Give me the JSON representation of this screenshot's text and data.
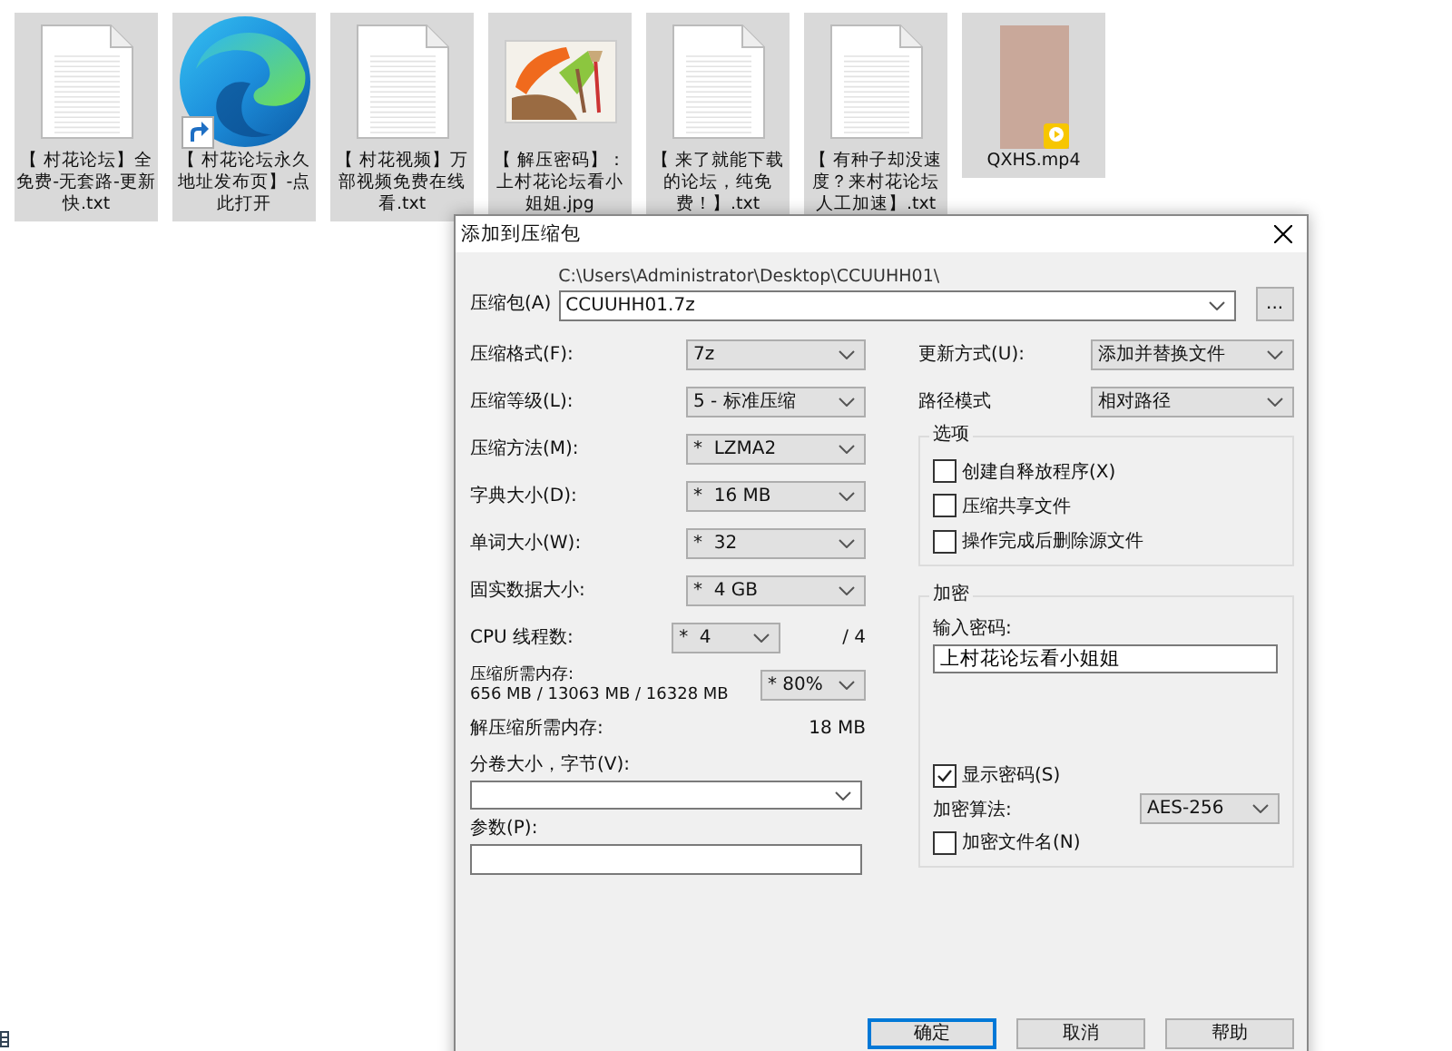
{
  "desktop": {
    "files": [
      {
        "name": "【 村花论坛】全免费-无套路-更新快.txt",
        "kind": "text"
      },
      {
        "name": "【 村花论坛永久地址发布页】-点此打开",
        "kind": "shortcut"
      },
      {
        "name": "【 村花视频】万部视频免费在线看.txt",
        "kind": "text"
      },
      {
        "name": "【 解压密码】：上村花论坛看小姐姐.jpg",
        "kind": "image"
      },
      {
        "name": "【 来了就能下载的论坛，纯免费！】.txt",
        "kind": "text"
      },
      {
        "name": "【 有种子却没速度？来村花论坛人工加速】.txt",
        "kind": "text"
      },
      {
        "name": "QXHS.mp4",
        "kind": "video"
      }
    ]
  },
  "dialog": {
    "title": "添加到压缩包",
    "archive": {
      "label": "压缩包(A)",
      "path": "C:\\Users\\Administrator\\Desktop\\CCUUHH01\\",
      "value": "CCUUHH01.7z",
      "browse": "..."
    },
    "settings": [
      {
        "label": "压缩格式(F):",
        "value": "7z",
        "kind": "combo"
      },
      {
        "label": "压缩等级(L):",
        "value": "5 - 标准压缩",
        "kind": "combo"
      },
      {
        "label": "压缩方法(M):",
        "value": "*  LZMA2",
        "kind": "combo"
      },
      {
        "label": "字典大小(D):",
        "value": "*  16 MB",
        "kind": "combo"
      },
      {
        "label": "单词大小(W):",
        "value": "*  32",
        "kind": "combo"
      },
      {
        "label": "固实数据大小:",
        "value": "*  4 GB",
        "kind": "combo"
      },
      {
        "label": "CPU 线程数:",
        "value": "*  4",
        "suffix": "/ 4",
        "kind": "short"
      }
    ],
    "memory": {
      "label": "压缩所需内存:",
      "values": "656 MB / 13063 MB / 16328 MB",
      "value": "* 80%"
    },
    "decompress_memory": {
      "label": "解压缩所需内存:",
      "value": "18 MB"
    },
    "volume": {
      "label": "分卷大小，字节(V):"
    },
    "parameters": {
      "label": "参数(P):"
    },
    "update_mode": {
      "label": "更新方式(U):",
      "value": "添加并替换文件"
    },
    "path_mode": {
      "label": "路径模式",
      "value": "相对路径"
    },
    "options": {
      "title": "选项",
      "items": [
        {
          "label": "创建自释放程序(X)",
          "checked": false
        },
        {
          "label": "压缩共享文件",
          "checked": false
        },
        {
          "label": "操作完成后删除源文件",
          "checked": false
        }
      ]
    },
    "encryption": {
      "title": "加密",
      "password_label": "输入密码:",
      "password": "上村花论坛看小姐姐",
      "show_password": {
        "label": "显示密码(S)",
        "checked": true
      },
      "method_label": "加密算法:",
      "method": "AES-256",
      "encrypt_names": {
        "label": "加密文件名(N)",
        "checked": false
      }
    },
    "buttons": [
      {
        "label": "确定",
        "selected": true
      },
      {
        "label": "取消",
        "selected": false
      },
      {
        "label": "帮助",
        "selected": false
      }
    ]
  }
}
